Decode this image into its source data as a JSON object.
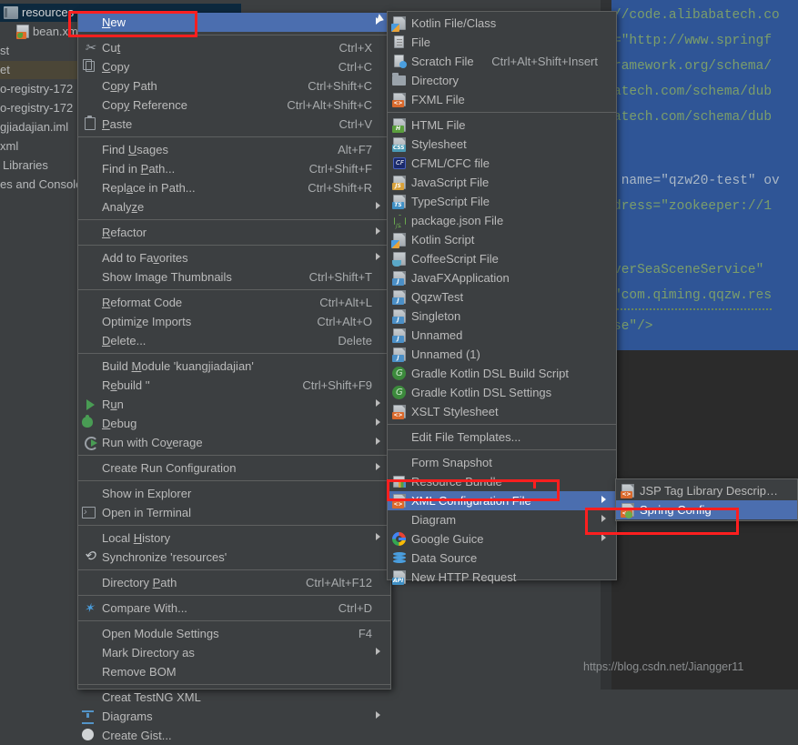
{
  "project_panel": {
    "rows": [
      {
        "label": "resources",
        "icon": "folder-icon",
        "state": "selected-blue"
      },
      {
        "label": "bean.xml",
        "icon": "xml-file-icon",
        "state": "normal"
      },
      {
        "label": "st",
        "icon": "none",
        "state": "normal"
      },
      {
        "label": "et",
        "icon": "none",
        "state": "selected-olive"
      },
      {
        "label": "o-registry-172",
        "icon": "none",
        "state": "normal"
      },
      {
        "label": "o-registry-172",
        "icon": "none",
        "state": "normal"
      },
      {
        "label": "gjiadajian.iml",
        "icon": "none",
        "state": "normal"
      },
      {
        "label": "xml",
        "icon": "none",
        "state": "normal"
      },
      {
        "label": "Libraries",
        "icon": "none",
        "state": "normal"
      },
      {
        "label": "es and Console",
        "icon": "none",
        "state": "normal"
      }
    ]
  },
  "editor": {
    "lines": [
      "//code.alibabatech.co",
      "=\"http://www.springf",
      "ramework.org/schema/",
      "atech.com/schema/dub",
      "atech.com/schema/dub",
      "",
      " name=\"qzw20-test\" ov",
      "dress=\"zookeeper://1",
      "",
      "verSeaSceneService\"",
      "\"com.qiming.qqzw.res",
      "se\"/>"
    ]
  },
  "watermark": "https://blog.csdn.net/Jiangger11",
  "context_menu": {
    "items": [
      {
        "label": "New",
        "accel": "",
        "icon": "none",
        "arrow": true,
        "selected": true,
        "sep_after": true,
        "underline": "N"
      },
      {
        "label": "Cut",
        "accel": "Ctrl+X",
        "icon": "cut-icon",
        "arrow": false,
        "underline": "t"
      },
      {
        "label": "Copy",
        "accel": "Ctrl+C",
        "icon": "copy-icon",
        "arrow": false,
        "underline": "C"
      },
      {
        "label": "Copy Path",
        "accel": "Ctrl+Shift+C",
        "icon": "none",
        "arrow": false,
        "underline": "o"
      },
      {
        "label": "Copy Reference",
        "accel": "Ctrl+Alt+Shift+C",
        "icon": "none",
        "arrow": false,
        "underline": "y"
      },
      {
        "label": "Paste",
        "accel": "Ctrl+V",
        "icon": "paste-icon",
        "arrow": false,
        "sep_after": true,
        "underline": "P"
      },
      {
        "label": "Find Usages",
        "accel": "Alt+F7",
        "icon": "none",
        "arrow": false,
        "underline": "U"
      },
      {
        "label": "Find in Path...",
        "accel": "Ctrl+Shift+F",
        "icon": "none",
        "arrow": false,
        "underline": "P"
      },
      {
        "label": "Replace in Path...",
        "accel": "Ctrl+Shift+R",
        "icon": "none",
        "arrow": false,
        "underline": "a"
      },
      {
        "label": "Analyze",
        "accel": "",
        "icon": "none",
        "arrow": true,
        "sep_after": true,
        "underline": "z"
      },
      {
        "label": "Refactor",
        "accel": "",
        "icon": "none",
        "arrow": true,
        "sep_after": true,
        "underline": "R"
      },
      {
        "label": "Add to Favorites",
        "accel": "",
        "icon": "none",
        "arrow": true,
        "underline": "v"
      },
      {
        "label": "Show Image Thumbnails",
        "accel": "Ctrl+Shift+T",
        "icon": "none",
        "arrow": false,
        "sep_after": true
      },
      {
        "label": "Reformat Code",
        "accel": "Ctrl+Alt+L",
        "icon": "none",
        "arrow": false,
        "underline": "R"
      },
      {
        "label": "Optimize Imports",
        "accel": "Ctrl+Alt+O",
        "icon": "none",
        "arrow": false,
        "underline": "z"
      },
      {
        "label": "Delete...",
        "accel": "Delete",
        "icon": "none",
        "arrow": false,
        "sep_after": true,
        "underline": "D"
      },
      {
        "label": "Build Module 'kuangjiadajian'",
        "accel": "",
        "icon": "none",
        "arrow": false,
        "underline": "M"
      },
      {
        "label": "Rebuild '<default>'",
        "accel": "Ctrl+Shift+F9",
        "icon": "none",
        "arrow": false,
        "underline": "e"
      },
      {
        "label": "Run",
        "accel": "",
        "icon": "run-icon",
        "arrow": true,
        "underline": "u"
      },
      {
        "label": "Debug",
        "accel": "",
        "icon": "debug-icon",
        "arrow": true,
        "underline": "D"
      },
      {
        "label": "Run with Coverage",
        "accel": "",
        "icon": "coverage-icon",
        "arrow": true,
        "sep_after": true,
        "underline": "v"
      },
      {
        "label": "Create Run Configuration",
        "accel": "",
        "icon": "none",
        "arrow": true,
        "sep_after": true
      },
      {
        "label": "Show in Explorer",
        "accel": "",
        "icon": "none",
        "arrow": false
      },
      {
        "label": "Open in Terminal",
        "accel": "",
        "icon": "terminal-icon",
        "arrow": false,
        "sep_after": true
      },
      {
        "label": "Local History",
        "accel": "",
        "icon": "none",
        "arrow": true,
        "underline": "H"
      },
      {
        "label": "Synchronize 'resources'",
        "accel": "",
        "icon": "sync-icon",
        "arrow": false,
        "sep_after": true
      },
      {
        "label": "Directory Path",
        "accel": "Ctrl+Alt+F12",
        "icon": "none",
        "arrow": false,
        "sep_after": true,
        "underline": "P"
      },
      {
        "label": "Compare With...",
        "accel": "Ctrl+D",
        "icon": "compare-icon",
        "arrow": false,
        "sep_after": true
      },
      {
        "label": "Open Module Settings",
        "accel": "F4",
        "icon": "none",
        "arrow": false
      },
      {
        "label": "Mark Directory as",
        "accel": "",
        "icon": "none",
        "arrow": true
      },
      {
        "label": "Remove BOM",
        "accel": "",
        "icon": "none",
        "arrow": false,
        "sep_after": true
      },
      {
        "label": "Creat TestNG XML",
        "accel": "",
        "icon": "none",
        "arrow": false
      },
      {
        "label": "Diagrams",
        "accel": "",
        "icon": "diagrams-icon",
        "arrow": true
      },
      {
        "label": "Create Gist...",
        "accel": "",
        "icon": "gist-icon",
        "arrow": false
      }
    ]
  },
  "new_submenu": {
    "items": [
      {
        "label": "Kotlin File/Class",
        "accel": "",
        "icon": "kotlin-file-icon",
        "arrow": false
      },
      {
        "label": "File",
        "accel": "",
        "icon": "plain-file-icon",
        "arrow": false
      },
      {
        "label": "Scratch File",
        "accel": "Ctrl+Alt+Shift+Insert",
        "icon": "scratch-file-icon",
        "arrow": false
      },
      {
        "label": "Directory",
        "accel": "",
        "icon": "directory-icon",
        "arrow": false
      },
      {
        "label": "FXML File",
        "accel": "",
        "icon": "fxml-file-icon",
        "arrow": false,
        "sep_after": true
      },
      {
        "label": "HTML File",
        "accel": "",
        "icon": "html-file-icon",
        "arrow": false
      },
      {
        "label": "Stylesheet",
        "accel": "",
        "icon": "css-file-icon",
        "arrow": false
      },
      {
        "label": "CFML/CFC file",
        "accel": "",
        "icon": "cfml-file-icon",
        "arrow": false
      },
      {
        "label": "JavaScript File",
        "accel": "",
        "icon": "javascript-file-icon",
        "arrow": false
      },
      {
        "label": "TypeScript File",
        "accel": "",
        "icon": "typescript-file-icon",
        "arrow": false
      },
      {
        "label": "package.json File",
        "accel": "",
        "icon": "nodejs-icon",
        "arrow": false
      },
      {
        "label": "Kotlin Script",
        "accel": "",
        "icon": "kotlin-script-icon",
        "arrow": false
      },
      {
        "label": "CoffeeScript File",
        "accel": "",
        "icon": "coffeescript-icon",
        "arrow": false
      },
      {
        "label": "JavaFXApplication",
        "accel": "",
        "icon": "java-file-icon",
        "arrow": false
      },
      {
        "label": "QqzwTest",
        "accel": "",
        "icon": "java-file-icon",
        "arrow": false
      },
      {
        "label": "Singleton",
        "accel": "",
        "icon": "java-file-icon",
        "arrow": false
      },
      {
        "label": "Unnamed",
        "accel": "",
        "icon": "java-file-icon",
        "arrow": false
      },
      {
        "label": "Unnamed (1)",
        "accel": "",
        "icon": "java-file-icon",
        "arrow": false
      },
      {
        "label": "Gradle Kotlin DSL Build Script",
        "accel": "",
        "icon": "gradle-icon",
        "arrow": false
      },
      {
        "label": "Gradle Kotlin DSL Settings",
        "accel": "",
        "icon": "gradle-icon",
        "arrow": false
      },
      {
        "label": "XSLT Stylesheet",
        "accel": "",
        "icon": "xslt-file-icon",
        "arrow": false,
        "sep_after": true
      },
      {
        "label": "Edit File Templates...",
        "accel": "",
        "icon": "none",
        "arrow": false,
        "sep_after": true
      },
      {
        "label": "Form Snapshot",
        "accel": "",
        "icon": "none",
        "arrow": false
      },
      {
        "label": "Resource Bundle",
        "accel": "",
        "icon": "resource-bundle-icon",
        "arrow": false
      },
      {
        "label": "XML Configuration File",
        "accel": "",
        "icon": "xml-config-icon",
        "arrow": true,
        "selected": true
      },
      {
        "label": "Diagram",
        "accel": "",
        "icon": "none",
        "arrow": true
      },
      {
        "label": "Google Guice",
        "accel": "",
        "icon": "google-icon",
        "arrow": true
      },
      {
        "label": "Data Source",
        "accel": "",
        "icon": "data-source-icon",
        "arrow": false
      },
      {
        "label": "New HTTP Request",
        "accel": "",
        "icon": "http-request-icon",
        "arrow": false
      }
    ]
  },
  "xml_config_submenu": {
    "items": [
      {
        "label": "JSP Tag Library Descriptor",
        "icon": "xml-file-icon",
        "selected": false
      },
      {
        "label": "Spring Config",
        "icon": "spring-config-icon",
        "selected": true
      }
    ]
  },
  "colors": {
    "menu_bg": "#3c3f41",
    "menu_border": "#5e6060",
    "selection": "#4b6eaf",
    "text": "#bbbbbb",
    "annotation_red": "#ff1f1f",
    "editor_bg": "#2b2b2b",
    "editor_selection": "#2f5596",
    "code_text": "#7c9e6a"
  }
}
